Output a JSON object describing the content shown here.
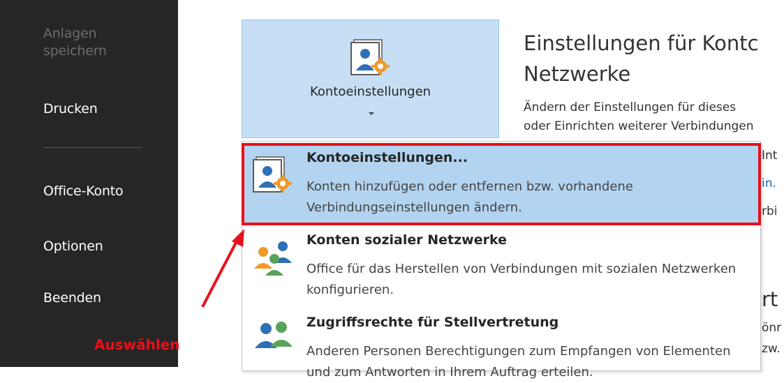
{
  "sidebar": {
    "items": [
      {
        "label": "Anlagen speichern",
        "enabled": false
      },
      {
        "label": "Drucken",
        "enabled": true
      },
      {
        "label": "Office-Konto",
        "enabled": true
      },
      {
        "label": "Optionen",
        "enabled": true
      },
      {
        "label": "Beenden",
        "enabled": true
      }
    ]
  },
  "split_button": {
    "label": "Kontoeinstellungen",
    "icon": "account-settings-icon"
  },
  "info": {
    "title": "Einstellungen für Kontc\nNetzwerke",
    "description": "Ändern der Einstellungen für dieses\noder Einrichten weiterer Verbindungen",
    "fragments": [
      "Int",
      "in.",
      "rbi",
      "rt",
      "önr",
      "zw."
    ]
  },
  "menu": {
    "items": [
      {
        "title": "Kontoeinstellungen...",
        "description": "Konten hinzufügen oder entfernen bzw. vorhandene Verbindungseinstellungen ändern.",
        "icon": "account-settings-icon",
        "selected": true
      },
      {
        "title": "Konten sozialer Netzwerke",
        "description": "Office für das Herstellen von Verbindungen mit sozialen Netzwerken konfigurieren.",
        "icon": "social-network-accounts-icon",
        "selected": false
      },
      {
        "title": "Zugriffsrechte für Stellvertretung",
        "description": "Anderen Personen Berechtigungen zum Empfangen von Elementen und zum Antworten in Ihrem Auftrag erteilen.",
        "icon": "delegate-access-icon",
        "selected": false
      }
    ]
  },
  "annotation": {
    "label": "Auswählen",
    "color": "#e8101a"
  },
  "colors": {
    "sidebar_bg": "#262626",
    "selected_bg": "#b3d4f0",
    "button_bg": "#c7dff4",
    "highlight": "#e8101a"
  }
}
